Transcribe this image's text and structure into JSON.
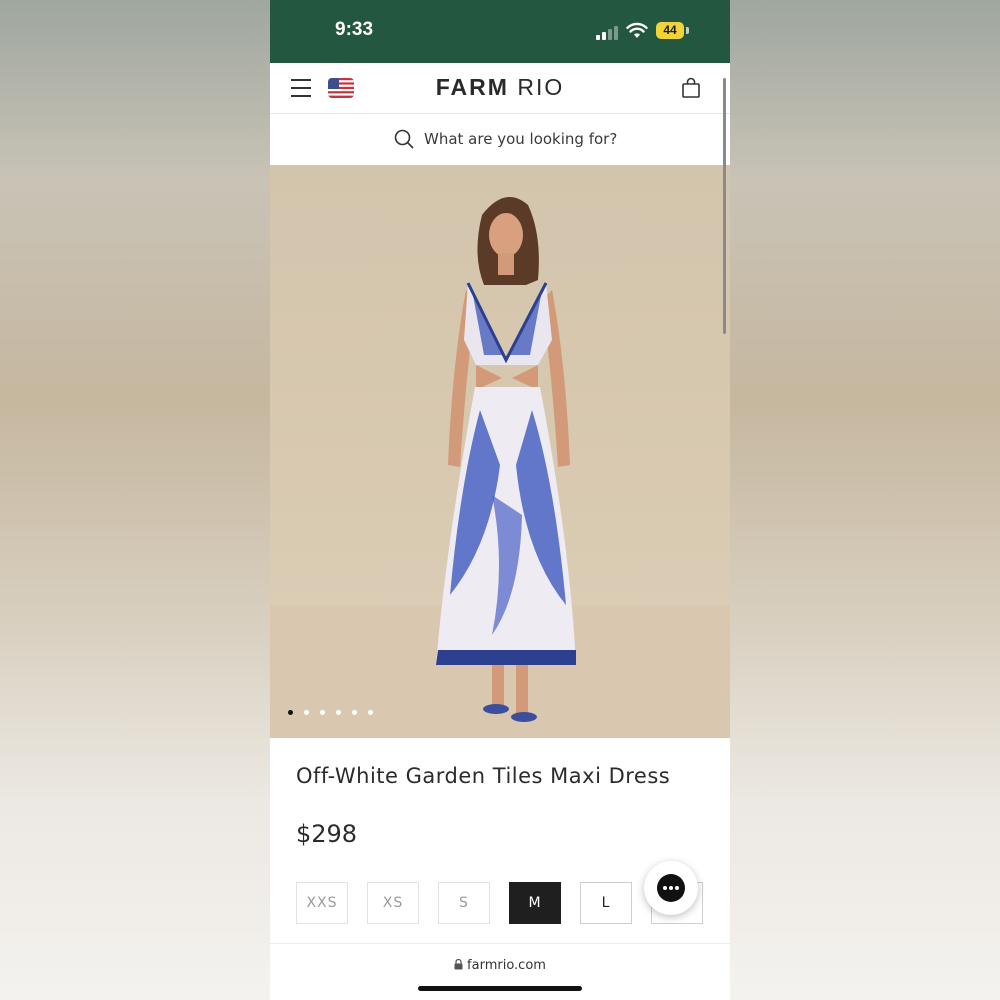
{
  "status_bar": {
    "time": "9:33",
    "battery": "44",
    "background_color": "#24573f"
  },
  "header": {
    "menu_icon": "hamburger-icon",
    "flag_icon": "us-flag-icon",
    "logo_bold": "FARM",
    "logo_light": "RIO",
    "bag_icon": "shopping-bag-icon"
  },
  "search": {
    "placeholder": "What are you looking for?"
  },
  "gallery": {
    "image_count": 6,
    "active_index": 0
  },
  "product": {
    "title": "Off-White Garden Tiles Maxi Dress",
    "price": "$298",
    "sizes": [
      {
        "label": "XXS",
        "state": "unavailable"
      },
      {
        "label": "XS",
        "state": "unavailable"
      },
      {
        "label": "S",
        "state": "unavailable"
      },
      {
        "label": "M",
        "state": "selected"
      },
      {
        "label": "L",
        "state": "available"
      },
      {
        "label": "",
        "state": "available"
      }
    ]
  },
  "chat": {
    "icon": "chat-bubble-icon"
  },
  "browser": {
    "url": "farmrio.com",
    "lock_icon": "lock-icon"
  }
}
